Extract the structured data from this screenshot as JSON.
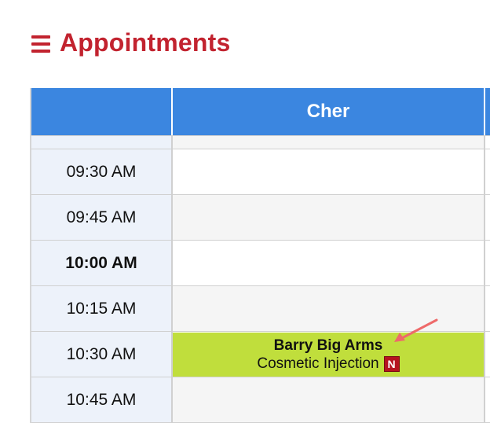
{
  "header": {
    "menu_icon": "hamburger-menu-icon",
    "title": "Appointments",
    "accent_color": "#c2232f"
  },
  "calendar": {
    "header_color": "#3b86e0",
    "column_header": "Cher",
    "slots": [
      {
        "time": "09:30 AM"
      },
      {
        "time": "09:45 AM"
      },
      {
        "time": "10:00 AM"
      },
      {
        "time": "10:15 AM"
      },
      {
        "time": "10:30 AM"
      },
      {
        "time": "10:45 AM"
      }
    ],
    "appointment": {
      "client": "Barry Big Arms",
      "service": "Cosmetic Injection",
      "badge": "N",
      "color": "#c0de3c"
    }
  },
  "annotation": {
    "icon": "pointer-arrow-icon",
    "color": "#ee6a6a"
  }
}
